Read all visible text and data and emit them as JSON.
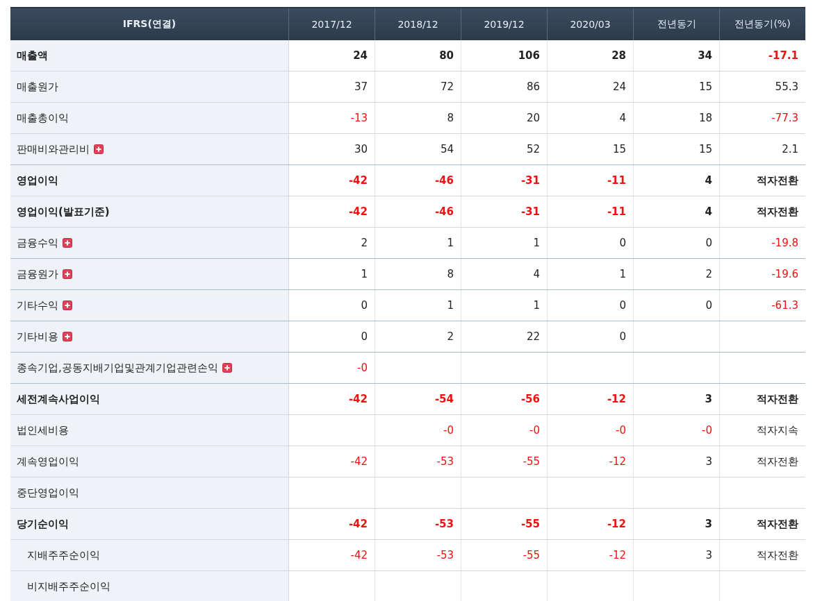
{
  "table": {
    "label_column": "IFRS(연결)",
    "columns": [
      "2017/12",
      "2018/12",
      "2019/12",
      "2020/03",
      "전년동기",
      "전년동기(%)"
    ],
    "rows": [
      {
        "label": "매출액",
        "bold": true,
        "expandable": false,
        "cells": [
          {
            "value": "24",
            "negative": false
          },
          {
            "value": "80",
            "negative": false
          },
          {
            "value": "106",
            "negative": false
          },
          {
            "value": "28",
            "negative": false
          },
          {
            "value": "34",
            "negative": false
          },
          {
            "value": "-17.1",
            "negative": true
          }
        ]
      },
      {
        "label": "매출원가",
        "bold": false,
        "expandable": false,
        "cells": [
          {
            "value": "37",
            "negative": false
          },
          {
            "value": "72",
            "negative": false
          },
          {
            "value": "86",
            "negative": false
          },
          {
            "value": "24",
            "negative": false
          },
          {
            "value": "15",
            "negative": false
          },
          {
            "value": "55.3",
            "negative": false
          }
        ]
      },
      {
        "label": "매출총이익",
        "bold": false,
        "expandable": false,
        "cells": [
          {
            "value": "-13",
            "negative": true
          },
          {
            "value": "8",
            "negative": false
          },
          {
            "value": "20",
            "negative": false
          },
          {
            "value": "4",
            "negative": false
          },
          {
            "value": "18",
            "negative": false
          },
          {
            "value": "-77.3",
            "negative": true
          }
        ]
      },
      {
        "label": "판매비와관리비",
        "bold": false,
        "expandable": true,
        "cells": [
          {
            "value": "30",
            "negative": false
          },
          {
            "value": "54",
            "negative": false
          },
          {
            "value": "52",
            "negative": false
          },
          {
            "value": "15",
            "negative": false
          },
          {
            "value": "15",
            "negative": false
          },
          {
            "value": "2.1",
            "negative": false
          }
        ]
      },
      {
        "label": "영업이익",
        "bold": true,
        "expandable": false,
        "cells": [
          {
            "value": "-42",
            "negative": true
          },
          {
            "value": "-46",
            "negative": true
          },
          {
            "value": "-31",
            "negative": true
          },
          {
            "value": "-11",
            "negative": true
          },
          {
            "value": "4",
            "negative": false
          },
          {
            "value": "적자전환",
            "negative": false
          }
        ]
      },
      {
        "label": "영업이익(발표기준)",
        "bold": true,
        "expandable": false,
        "cells": [
          {
            "value": "-42",
            "negative": true
          },
          {
            "value": "-46",
            "negative": true
          },
          {
            "value": "-31",
            "negative": true
          },
          {
            "value": "-11",
            "negative": true
          },
          {
            "value": "4",
            "negative": false
          },
          {
            "value": "적자전환",
            "negative": false
          }
        ]
      },
      {
        "label": "금융수익",
        "bold": false,
        "expandable": true,
        "cells": [
          {
            "value": "2",
            "negative": false
          },
          {
            "value": "1",
            "negative": false
          },
          {
            "value": "1",
            "negative": false
          },
          {
            "value": "0",
            "negative": false
          },
          {
            "value": "0",
            "negative": false
          },
          {
            "value": "-19.8",
            "negative": true
          }
        ]
      },
      {
        "label": "금융원가",
        "bold": false,
        "expandable": true,
        "cells": [
          {
            "value": "1",
            "negative": false
          },
          {
            "value": "8",
            "negative": false
          },
          {
            "value": "4",
            "negative": false
          },
          {
            "value": "1",
            "negative": false
          },
          {
            "value": "2",
            "negative": false
          },
          {
            "value": "-19.6",
            "negative": true
          }
        ]
      },
      {
        "label": "기타수익",
        "bold": false,
        "expandable": true,
        "cells": [
          {
            "value": "0",
            "negative": false
          },
          {
            "value": "1",
            "negative": false
          },
          {
            "value": "1",
            "negative": false
          },
          {
            "value": "0",
            "negative": false
          },
          {
            "value": "0",
            "negative": false
          },
          {
            "value": "-61.3",
            "negative": true
          }
        ]
      },
      {
        "label": "기타비용",
        "bold": false,
        "expandable": true,
        "cells": [
          {
            "value": "0",
            "negative": false
          },
          {
            "value": "2",
            "negative": false
          },
          {
            "value": "22",
            "negative": false
          },
          {
            "value": "0",
            "negative": false
          },
          null,
          null
        ]
      },
      {
        "label": "종속기업,공동지배기업및관계기업관련손익",
        "bold": false,
        "expandable": true,
        "cells": [
          {
            "value": "-0",
            "negative": true
          },
          null,
          null,
          null,
          null,
          null
        ]
      },
      {
        "label": "세전계속사업이익",
        "bold": true,
        "expandable": false,
        "cells": [
          {
            "value": "-42",
            "negative": true
          },
          {
            "value": "-54",
            "negative": true
          },
          {
            "value": "-56",
            "negative": true
          },
          {
            "value": "-12",
            "negative": true
          },
          {
            "value": "3",
            "negative": false
          },
          {
            "value": "적자전환",
            "negative": false
          }
        ]
      },
      {
        "label": "법인세비용",
        "bold": false,
        "expandable": false,
        "cells": [
          null,
          {
            "value": "-0",
            "negative": true
          },
          {
            "value": "-0",
            "negative": true
          },
          {
            "value": "-0",
            "negative": true
          },
          {
            "value": "-0",
            "negative": true
          },
          {
            "value": "적자지속",
            "negative": false
          }
        ]
      },
      {
        "label": "계속영업이익",
        "bold": false,
        "expandable": false,
        "cells": [
          {
            "value": "-42",
            "negative": true
          },
          {
            "value": "-53",
            "negative": true
          },
          {
            "value": "-55",
            "negative": true
          },
          {
            "value": "-12",
            "negative": true
          },
          {
            "value": "3",
            "negative": false
          },
          {
            "value": "적자전환",
            "negative": false
          }
        ]
      },
      {
        "label": "중단영업이익",
        "bold": false,
        "expandable": false,
        "cells": [
          null,
          null,
          null,
          null,
          null,
          null
        ]
      },
      {
        "label": "당기순이익",
        "bold": true,
        "expandable": false,
        "cells": [
          {
            "value": "-42",
            "negative": true
          },
          {
            "value": "-53",
            "negative": true
          },
          {
            "value": "-55",
            "negative": true
          },
          {
            "value": "-12",
            "negative": true
          },
          {
            "value": "3",
            "negative": false
          },
          {
            "value": "적자전환",
            "negative": false
          }
        ],
        "children": [
          {
            "label": "지배주주순이익",
            "bold": false,
            "expandable": false,
            "cells": [
              {
                "value": "-42",
                "negative": true
              },
              {
                "value": "-53",
                "negative": true
              },
              {
                "value": "-55",
                "negative": true
              },
              {
                "value": "-12",
                "negative": true
              },
              {
                "value": "3",
                "negative": false
              },
              {
                "value": "적자전환",
                "negative": false
              }
            ]
          },
          {
            "label": "비지배주주순이익",
            "bold": false,
            "expandable": false,
            "cells": [
              null,
              null,
              null,
              null,
              null,
              null
            ]
          }
        ]
      }
    ]
  }
}
